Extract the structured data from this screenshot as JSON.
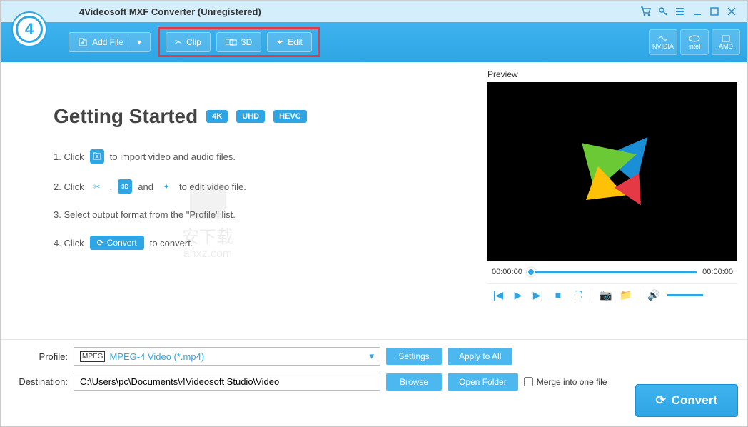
{
  "titlebar": {
    "title": "4Videosoft MXF Converter (Unregistered)"
  },
  "toolbar": {
    "logo_text": "4",
    "add_file": "Add File",
    "clip": "Clip",
    "three_d": "3D",
    "edit": "Edit",
    "hw": {
      "nvidia": "NVIDIA",
      "intel": "intel",
      "amd": "AMD"
    }
  },
  "main": {
    "heading": "Getting Started",
    "badges": {
      "b1": "4K",
      "b2": "UHD",
      "b3": "HEVC"
    },
    "step1_a": "1. Click",
    "step1_b": "to import video and audio files.",
    "step2_a": "2. Click",
    "step2_comma": ",",
    "step2_and": "and",
    "step2_b": "to edit video file.",
    "step3": "3. Select output format from the \"Profile\" list.",
    "step4_a": "4. Click",
    "step4_btn": "Convert",
    "step4_b": "to convert.",
    "watermark_text": "安下载",
    "watermark_sub": "anxz.com"
  },
  "preview": {
    "label": "Preview",
    "time_start": "00:00:00",
    "time_end": "00:00:00"
  },
  "profile": {
    "label": "Profile:",
    "value": "MPEG-4 Video (*.mp4)",
    "settings": "Settings",
    "apply_all": "Apply to All"
  },
  "destination": {
    "label": "Destination:",
    "value": "C:\\Users\\pc\\Documents\\4Videosoft Studio\\Video",
    "browse": "Browse",
    "open_folder": "Open Folder",
    "merge": "Merge into one file"
  },
  "convert": "Convert"
}
